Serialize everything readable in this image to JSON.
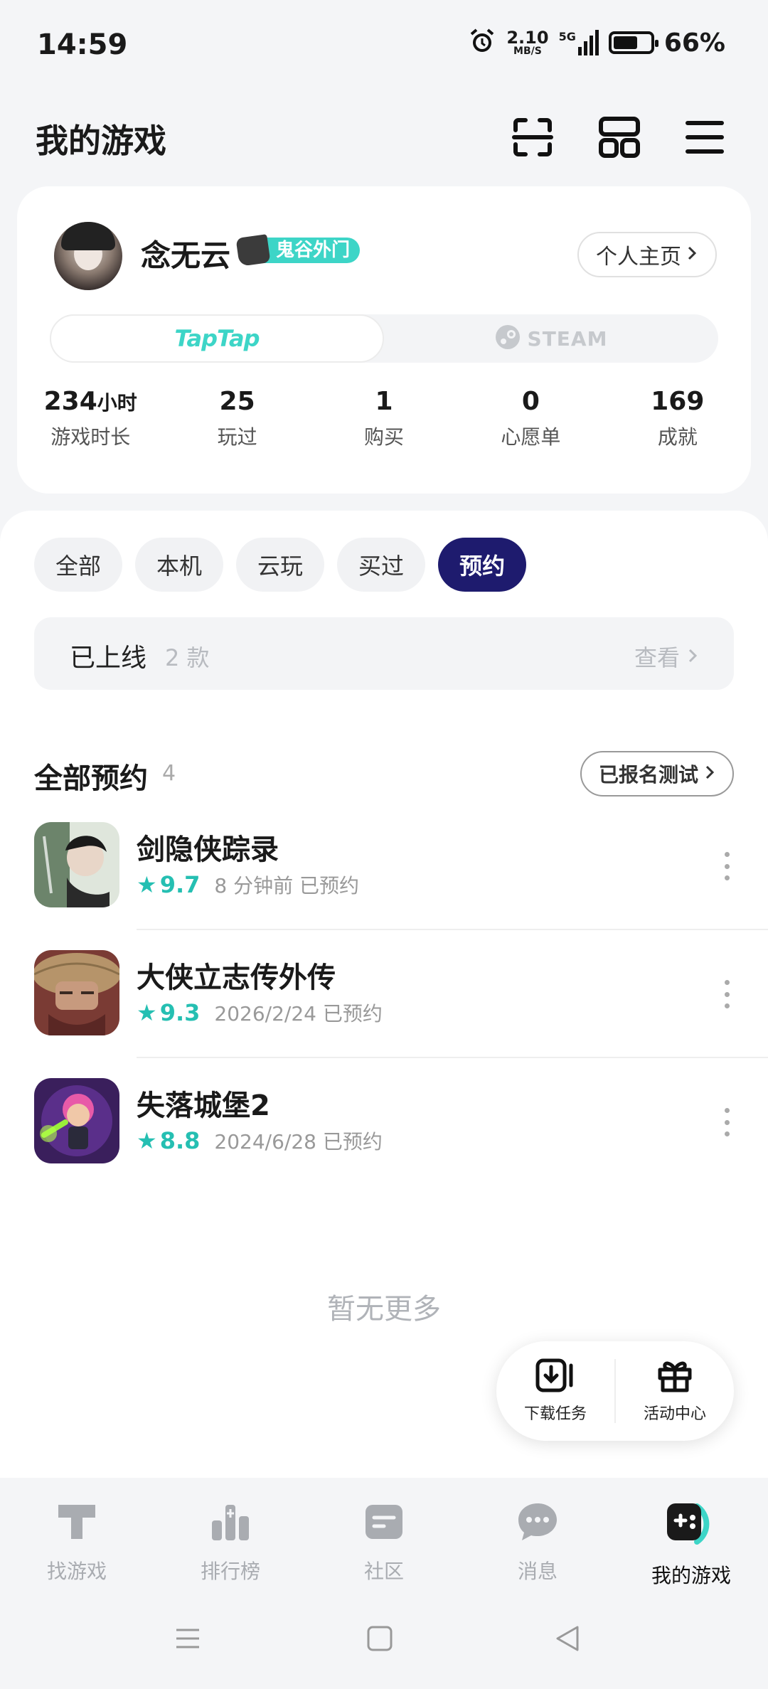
{
  "status_bar": {
    "time": "14:59",
    "net_speed": "2.10",
    "net_unit": "MB/S",
    "network_type": "5G",
    "battery": "66%",
    "battery_level": 0.66
  },
  "header": {
    "title": "我的游戏",
    "icons": [
      "scan-icon",
      "grid-icon",
      "menu-icon"
    ]
  },
  "profile": {
    "username": "念无云",
    "badge": "鬼谷外门",
    "homepage_label": "个人主页",
    "platforms": [
      "TapTap",
      "STEAM"
    ],
    "active_platform": "TapTap",
    "stats": [
      {
        "value": "234",
        "unit": "小时",
        "label": "游戏时长"
      },
      {
        "value": "25",
        "unit": "",
        "label": "玩过"
      },
      {
        "value": "1",
        "unit": "",
        "label": "购买"
      },
      {
        "value": "0",
        "unit": "",
        "label": "心愿单"
      },
      {
        "value": "169",
        "unit": "",
        "label": "成就"
      }
    ]
  },
  "filters": {
    "tabs": [
      "全部",
      "本机",
      "云玩",
      "买过",
      "预约"
    ],
    "active": "预约"
  },
  "online": {
    "label": "已上线",
    "count": "2 款",
    "view": "查看"
  },
  "reservations": {
    "title": "全部预约",
    "count": "4",
    "registered_btn": "已报名测试",
    "games": [
      {
        "name": "剑隐侠踪录",
        "rating": "9.7",
        "time": "8 分钟前",
        "status": "已预约",
        "accent": "#2e4a2e"
      },
      {
        "name": "大侠立志传外传",
        "rating": "9.3",
        "time": "2026/2/24",
        "status": "已预约",
        "accent": "#8a6f4a"
      },
      {
        "name": "失落城堡2",
        "rating": "8.8",
        "time": "2024/6/28",
        "status": "已预约",
        "accent": "#4a2a6e"
      }
    ],
    "no_more": "暂无更多"
  },
  "float_panel": {
    "download": "下载任务",
    "events": "活动中心"
  },
  "bottom_nav": {
    "items": [
      {
        "label": "找游戏",
        "icon": "find-games-icon"
      },
      {
        "label": "排行榜",
        "icon": "ranking-icon"
      },
      {
        "label": "社区",
        "icon": "community-icon"
      },
      {
        "label": "消息",
        "icon": "message-icon"
      },
      {
        "label": "我的游戏",
        "icon": "my-games-icon"
      }
    ],
    "active": "我的游戏"
  },
  "colors": {
    "accent": "#3dd5c7",
    "active_tab": "#1e1b6e",
    "rating": "#25bfb2"
  }
}
